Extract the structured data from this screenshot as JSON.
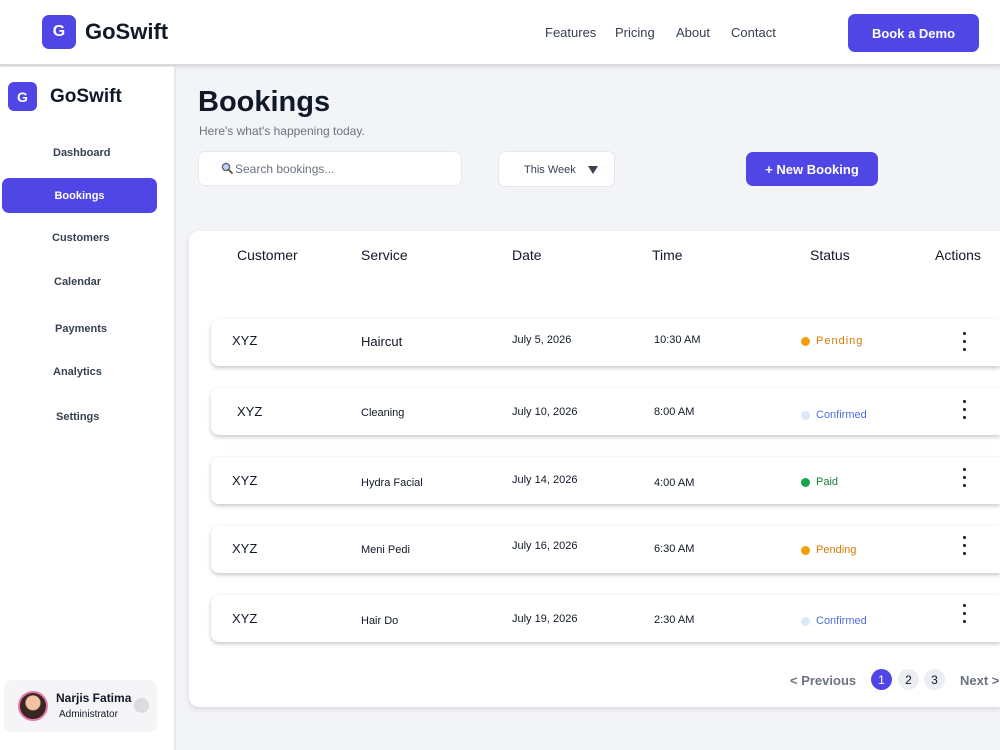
{
  "brand": {
    "initial": "G",
    "name": "GoSwift"
  },
  "topnav": {
    "links": [
      "Features",
      "Pricing",
      "About",
      "Contact"
    ],
    "cta": "Book a Demo"
  },
  "sidebar": {
    "items": [
      "Dashboard",
      "Bookings",
      "Customers",
      "Calendar",
      "Payments",
      "Analytics",
      "Settings"
    ],
    "active": "Bookings",
    "user": {
      "name": "Narjis Fatima",
      "role": "Administrator"
    }
  },
  "main": {
    "title": "Bookings",
    "subtitle": "Here's what's happening today.",
    "search_placeholder": "Search bookings...",
    "filter": "This Week",
    "new_button": "+ New Booking"
  },
  "table": {
    "columns": [
      "Customer",
      "Service",
      "Date",
      "Time",
      "Status",
      "Actions"
    ],
    "rows": [
      {
        "customer": "XYZ",
        "service": "Haircut",
        "date": "July 5, 2026",
        "time": "10:30 AM",
        "status": "Pending"
      },
      {
        "customer": "XYZ",
        "service": "Cleaning",
        "date": "July 10, 2026",
        "time": "8:00 AM",
        "status": "Confirmed"
      },
      {
        "customer": "XYZ",
        "service": "Hydra Facial",
        "date": "July 14, 2026",
        "time": "4:00 AM",
        "status": "Paid"
      },
      {
        "customer": "XYZ",
        "service": "Meni Pedi",
        "date": "July 16, 2026",
        "time": "6:30 AM",
        "status": "Pending"
      },
      {
        "customer": "XYZ",
        "service": "Hair Do",
        "date": "July 19, 2026",
        "time": "2:30 AM",
        "status": "Confirmed"
      }
    ]
  },
  "status_colors": {
    "Pending": {
      "dot": "#f59e0b",
      "text": "#d97706"
    },
    "Confirmed": {
      "dot": "#dbe7fb",
      "text": "#4f6fd9"
    },
    "Paid": {
      "dot": "#16a34a",
      "text": "#15803d"
    }
  },
  "pagination": {
    "prev": "< Previous",
    "pages": [
      "1",
      "2",
      "3"
    ],
    "current": "1",
    "next": "Next >"
  },
  "colors": {
    "accent": "#4f46e5"
  }
}
